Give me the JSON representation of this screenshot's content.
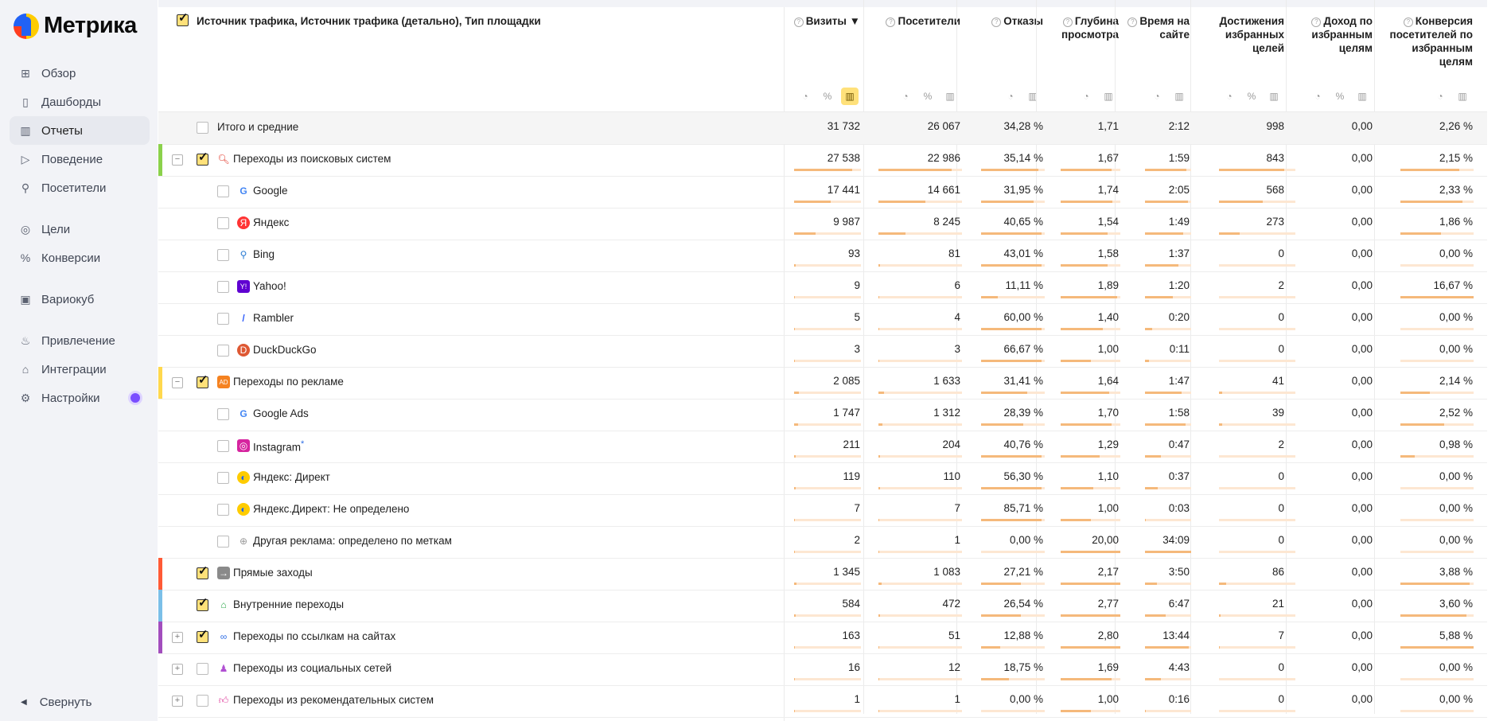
{
  "app": {
    "logo_text": "Метрика",
    "accent": "#ffe17a"
  },
  "sidebar": {
    "items": [
      {
        "label": "Обзор",
        "icon": "grid-icon",
        "active": false
      },
      {
        "label": "Дашборды",
        "icon": "dashboards-icon",
        "active": false
      },
      {
        "label": "Отчеты",
        "icon": "reports-icon",
        "active": true
      },
      {
        "label": "Поведение",
        "icon": "play-icon",
        "active": false
      },
      {
        "label": "Посетители",
        "icon": "user-icon",
        "active": false
      },
      {
        "label": "Цели",
        "icon": "target-icon",
        "active": false
      },
      {
        "label": "Конверсии",
        "icon": "percent-icon",
        "active": false
      },
      {
        "label": "Вариокуб",
        "icon": "variocube-icon",
        "active": false
      },
      {
        "label": "Привлечение",
        "icon": "flame-icon",
        "active": false
      },
      {
        "label": "Интеграции",
        "icon": "integrations-icon",
        "active": false
      },
      {
        "label": "Настройки",
        "icon": "gear-icon",
        "active": false
      }
    ],
    "collapse_label": "Свернуть"
  },
  "table": {
    "dimension_title": "Источник трафика, Источник трафика (детально), Тип площадки",
    "columns": [
      {
        "label": "Визиты ▼",
        "help": true
      },
      {
        "label": "Посетители",
        "help": true
      },
      {
        "label": "Отказы",
        "help": true
      },
      {
        "label": "Глубина просмотра",
        "help": true
      },
      {
        "label": "Время на сайте",
        "help": true
      },
      {
        "label": "Достижения избранных целей",
        "help": false
      },
      {
        "label": "Доход по избранным целям",
        "help": true
      },
      {
        "label": "Конверсия посетителей по избранным целям",
        "help": true
      }
    ],
    "total_label": "Итого и средние",
    "total": [
      "31 732",
      "26 067",
      "34,28 %",
      "1,71",
      "2:12",
      "998",
      "0,00",
      "2,26 %"
    ],
    "rows": [
      {
        "label": "Переходы из поисковых систем",
        "level": 0,
        "expander": "−",
        "checked": true,
        "color": "#8bd14b",
        "icon": "search-icon",
        "values": [
          "27 538",
          "22 986",
          "35,14 %",
          "1,67",
          "1:59",
          "843",
          "0,00",
          "2,15 %"
        ]
      },
      {
        "label": "Google",
        "level": 1,
        "icon": "google-icon",
        "values": [
          "17 441",
          "14 661",
          "31,95 %",
          "1,74",
          "2:05",
          "568",
          "0,00",
          "2,33 %"
        ]
      },
      {
        "label": "Яндекс",
        "level": 1,
        "icon": "yandex-icon",
        "values": [
          "9 987",
          "8 245",
          "40,65 %",
          "1,54",
          "1:49",
          "273",
          "0,00",
          "1,86 %"
        ]
      },
      {
        "label": "Bing",
        "level": 1,
        "icon": "bing-icon",
        "values": [
          "93",
          "81",
          "43,01 %",
          "1,58",
          "1:37",
          "0",
          "0,00",
          "0,00 %"
        ]
      },
      {
        "label": "Yahoo!",
        "level": 1,
        "icon": "yahoo-icon",
        "values": [
          "9",
          "6",
          "11,11 %",
          "1,89",
          "1:20",
          "2",
          "0,00",
          "16,67 %"
        ]
      },
      {
        "label": "Rambler",
        "level": 1,
        "icon": "rambler-icon",
        "values": [
          "5",
          "4",
          "60,00 %",
          "1,40",
          "0:20",
          "0",
          "0,00",
          "0,00 %"
        ]
      },
      {
        "label": "DuckDuckGo",
        "level": 1,
        "icon": "duckduckgo-icon",
        "values": [
          "3",
          "3",
          "66,67 %",
          "1,00",
          "0:11",
          "0",
          "0,00",
          "0,00 %"
        ]
      },
      {
        "label": "Переходы по рекламе",
        "level": 0,
        "expander": "−",
        "checked": true,
        "color": "#ffd84d",
        "icon": "ad-icon",
        "values": [
          "2 085",
          "1 633",
          "31,41 %",
          "1,64",
          "1:47",
          "41",
          "0,00",
          "2,14 %"
        ]
      },
      {
        "label": "Google Ads",
        "level": 1,
        "icon": "google-icon",
        "values": [
          "1 747",
          "1 312",
          "28,39 %",
          "1,70",
          "1:58",
          "39",
          "0,00",
          "2,52 %"
        ]
      },
      {
        "label": "Instagram",
        "level": 1,
        "icon": "instagram-icon",
        "asterisk": "*",
        "values": [
          "211",
          "204",
          "40,76 %",
          "1,29",
          "0:47",
          "2",
          "0,00",
          "0,98 %"
        ]
      },
      {
        "label": "Яндекс: Директ",
        "level": 1,
        "icon": "direct-icon",
        "values": [
          "119",
          "110",
          "56,30 %",
          "1,10",
          "0:37",
          "0",
          "0,00",
          "0,00 %"
        ]
      },
      {
        "label": "Яндекс.Директ: Не определено",
        "level": 1,
        "icon": "direct-icon",
        "values": [
          "7",
          "7",
          "85,71 %",
          "1,00",
          "0:03",
          "0",
          "0,00",
          "0,00 %"
        ]
      },
      {
        "label": "Другая реклама: определено по меткам",
        "level": 1,
        "icon": "globe-icon",
        "values": [
          "2",
          "1",
          "0,00 %",
          "20,00",
          "34:09",
          "0",
          "0,00",
          "0,00 %"
        ]
      },
      {
        "label": "Прямые заходы",
        "level": 0,
        "expander": "",
        "checked": true,
        "color": "#ff5a36",
        "icon": "enter-icon",
        "values": [
          "1 345",
          "1 083",
          "27,21 %",
          "2,17",
          "3:50",
          "86",
          "0,00",
          "3,88 %"
        ]
      },
      {
        "label": "Внутренние переходы",
        "level": 0,
        "expander": "",
        "checked": true,
        "color": "#7bbfe8",
        "icon": "home-icon",
        "values": [
          "584",
          "472",
          "26,54 %",
          "2,77",
          "6:47",
          "21",
          "0,00",
          "3,60 %"
        ]
      },
      {
        "label": "Переходы по ссылкам на сайтах",
        "level": 0,
        "expander": "+",
        "checked": true,
        "color": "#a24dbd",
        "icon": "link-icon",
        "values": [
          "163",
          "51",
          "12,88 %",
          "2,80",
          "13:44",
          "7",
          "0,00",
          "5,88 %"
        ]
      },
      {
        "label": "Переходы из социальных сетей",
        "level": 0,
        "expander": "+",
        "checked": false,
        "color": "",
        "icon": "social-icon",
        "values": [
          "16",
          "12",
          "18,75 %",
          "1,69",
          "4:43",
          "0",
          "0,00",
          "0,00 %"
        ]
      },
      {
        "label": "Переходы из рекомендательных систем",
        "level": 0,
        "expander": "+",
        "checked": false,
        "color": "",
        "icon": "thumbs-up-icon",
        "values": [
          "1",
          "1",
          "0,00 %",
          "1,00",
          "0:16",
          "0",
          "0,00",
          "0,00 %"
        ]
      }
    ],
    "bar_fractions": [
      [
        0.87,
        0.88,
        0.9,
        0.85,
        0.9,
        0.85,
        0,
        0.8
      ],
      [
        0.55,
        0.56,
        0.82,
        0.87,
        0.93,
        0.57,
        0,
        0.85
      ],
      [
        0.32,
        0.32,
        0.95,
        0.78,
        0.83,
        0.27,
        0,
        0.55
      ],
      [
        0.02,
        0.02,
        0.95,
        0.79,
        0.73,
        0.0,
        0,
        0.0
      ],
      [
        0.01,
        0.01,
        0.26,
        0.94,
        0.6,
        0.0,
        0,
        1.0
      ],
      [
        0.01,
        0.01,
        0.95,
        0.7,
        0.15,
        0.0,
        0,
        0.0
      ],
      [
        0.01,
        0.01,
        0.95,
        0.5,
        0.08,
        0.0,
        0,
        0.0
      ],
      [
        0.07,
        0.07,
        0.73,
        0.82,
        0.8,
        0.04,
        0,
        0.4
      ],
      [
        0.06,
        0.05,
        0.66,
        0.85,
        0.88,
        0.04,
        0,
        0.6
      ],
      [
        0.02,
        0.02,
        0.95,
        0.65,
        0.35,
        0.0,
        0,
        0.2
      ],
      [
        0.02,
        0.02,
        0.95,
        0.55,
        0.28,
        0.0,
        0,
        0.0
      ],
      [
        0.01,
        0.01,
        0.95,
        0.5,
        0.02,
        0.0,
        0,
        0.0
      ],
      [
        0.01,
        0.01,
        0.0,
        1.0,
        1.0,
        0.0,
        0,
        0.0
      ],
      [
        0.04,
        0.04,
        0.63,
        1.0,
        0.25,
        0.09,
        0,
        0.95
      ],
      [
        0.02,
        0.02,
        0.62,
        1.0,
        0.45,
        0.02,
        0,
        0.9
      ],
      [
        0.01,
        0.01,
        0.3,
        1.0,
        0.95,
        0.01,
        0,
        1.0
      ],
      [
        0.01,
        0.01,
        0.44,
        0.85,
        0.35,
        0.0,
        0,
        0.0
      ],
      [
        0.01,
        0.01,
        0.0,
        0.5,
        0.02,
        0.0,
        0,
        0.0
      ]
    ]
  }
}
